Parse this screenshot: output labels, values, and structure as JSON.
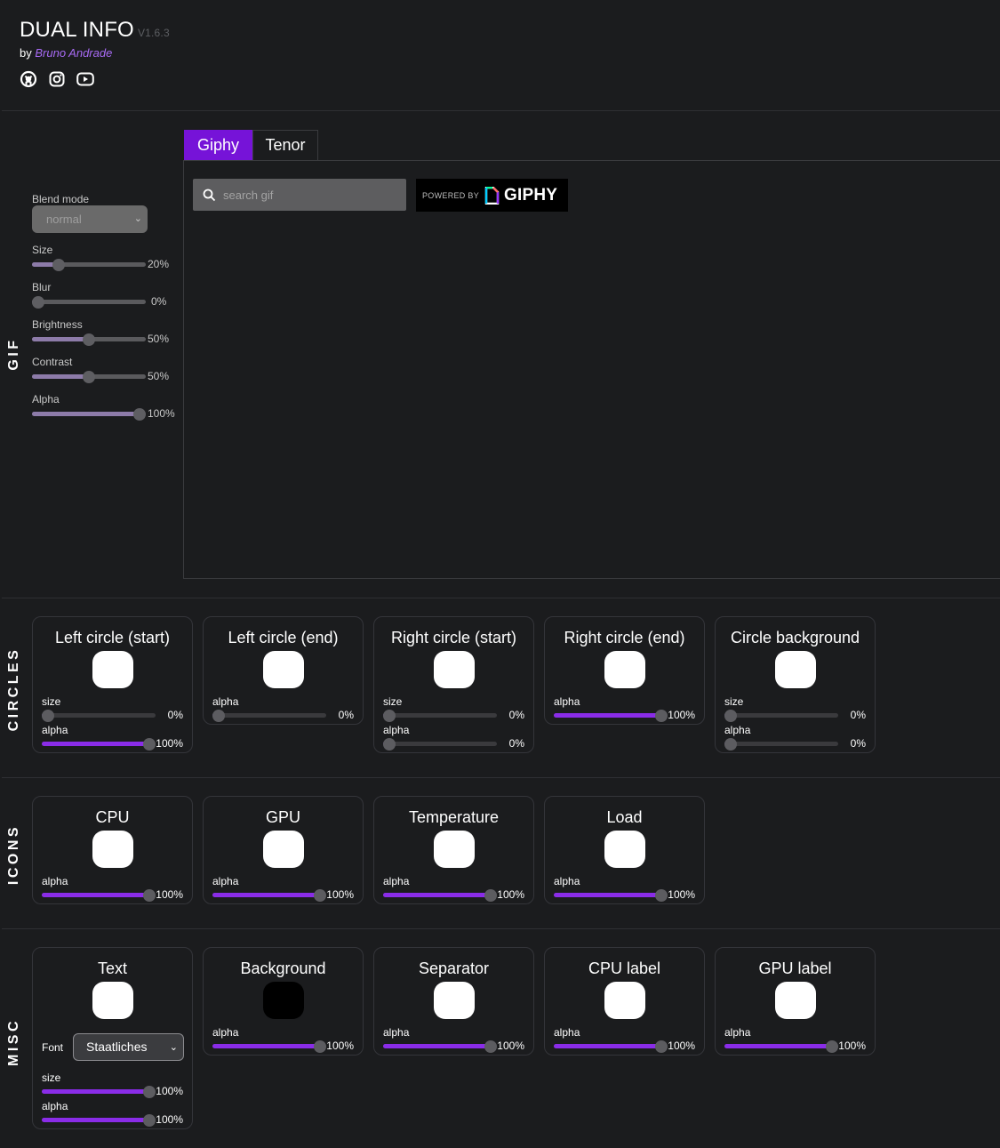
{
  "header": {
    "title": "DUAL INFO",
    "version": "V1.6.3",
    "by": "by",
    "author": "Bruno Andrade",
    "social": [
      "github-icon",
      "instagram-icon",
      "youtube-icon"
    ]
  },
  "colors": {
    "accent": "#7613d8",
    "slider_fill": "#8a2ce8",
    "author_link": "#a96bf6",
    "background": "#1b1c1e"
  },
  "sections": {
    "gif": "GIF",
    "circles": "CIRCLES",
    "icons": "ICONS",
    "misc": "MISC"
  },
  "gif": {
    "blend_label": "Blend mode",
    "blend_value": "normal",
    "sliders": [
      {
        "label": "Size",
        "value": 20,
        "text": "20%"
      },
      {
        "label": "Blur",
        "value": 0,
        "text": "0%"
      },
      {
        "label": "Brightness",
        "value": 50,
        "text": "50%"
      },
      {
        "label": "Contrast",
        "value": 50,
        "text": "50%"
      },
      {
        "label": "Alpha",
        "value": 100,
        "text": "100%"
      }
    ],
    "tabs": [
      "Giphy",
      "Tenor"
    ],
    "active_tab": "Giphy",
    "search_placeholder": "search gif",
    "powered_by": "POWERED BY",
    "giphy_logo": "GIPHY"
  },
  "circles": [
    {
      "title": "Left circle (start)",
      "color": "#ffffff",
      "sliders": [
        {
          "label": "size",
          "value": 0,
          "text": "0%"
        },
        {
          "label": "alpha",
          "value": 100,
          "text": "100%"
        }
      ]
    },
    {
      "title": "Left circle (end)",
      "color": "#ffffff",
      "sliders": [
        {
          "label": "alpha",
          "value": 0,
          "text": "0%"
        }
      ]
    },
    {
      "title": "Right circle (start)",
      "color": "#ffffff",
      "sliders": [
        {
          "label": "size",
          "value": 0,
          "text": "0%"
        },
        {
          "label": "alpha",
          "value": 0,
          "text": "0%"
        }
      ]
    },
    {
      "title": "Right circle (end)",
      "color": "#ffffff",
      "sliders": [
        {
          "label": "alpha",
          "value": 100,
          "text": "100%"
        }
      ]
    },
    {
      "title": "Circle background",
      "color": "#ffffff",
      "sliders": [
        {
          "label": "size",
          "value": 0,
          "text": "0%"
        },
        {
          "label": "alpha",
          "value": 0,
          "text": "0%"
        }
      ]
    }
  ],
  "icons": [
    {
      "title": "CPU",
      "color": "#ffffff",
      "sliders": [
        {
          "label": "alpha",
          "value": 100,
          "text": "100%"
        }
      ]
    },
    {
      "title": "GPU",
      "color": "#ffffff",
      "sliders": [
        {
          "label": "alpha",
          "value": 100,
          "text": "100%"
        }
      ]
    },
    {
      "title": "Temperature",
      "color": "#ffffff",
      "sliders": [
        {
          "label": "alpha",
          "value": 100,
          "text": "100%"
        }
      ]
    },
    {
      "title": "Load",
      "color": "#ffffff",
      "sliders": [
        {
          "label": "alpha",
          "value": 100,
          "text": "100%"
        }
      ]
    }
  ],
  "misc": [
    {
      "title": "Text",
      "color": "#ffffff",
      "font_label": "Font",
      "font_value": "Staatliches",
      "sliders": [
        {
          "label": "size",
          "value": 100,
          "text": "100%"
        },
        {
          "label": "alpha",
          "value": 100,
          "text": "100%"
        }
      ]
    },
    {
      "title": "Background",
      "color": "#000000",
      "sliders": [
        {
          "label": "alpha",
          "value": 100,
          "text": "100%"
        }
      ]
    },
    {
      "title": "Separator",
      "color": "#ffffff",
      "sliders": [
        {
          "label": "alpha",
          "value": 100,
          "text": "100%"
        }
      ]
    },
    {
      "title": "CPU label",
      "color": "#ffffff",
      "sliders": [
        {
          "label": "alpha",
          "value": 100,
          "text": "100%"
        }
      ]
    },
    {
      "title": "GPU label",
      "color": "#ffffff",
      "sliders": [
        {
          "label": "alpha",
          "value": 100,
          "text": "100%"
        }
      ]
    }
  ]
}
